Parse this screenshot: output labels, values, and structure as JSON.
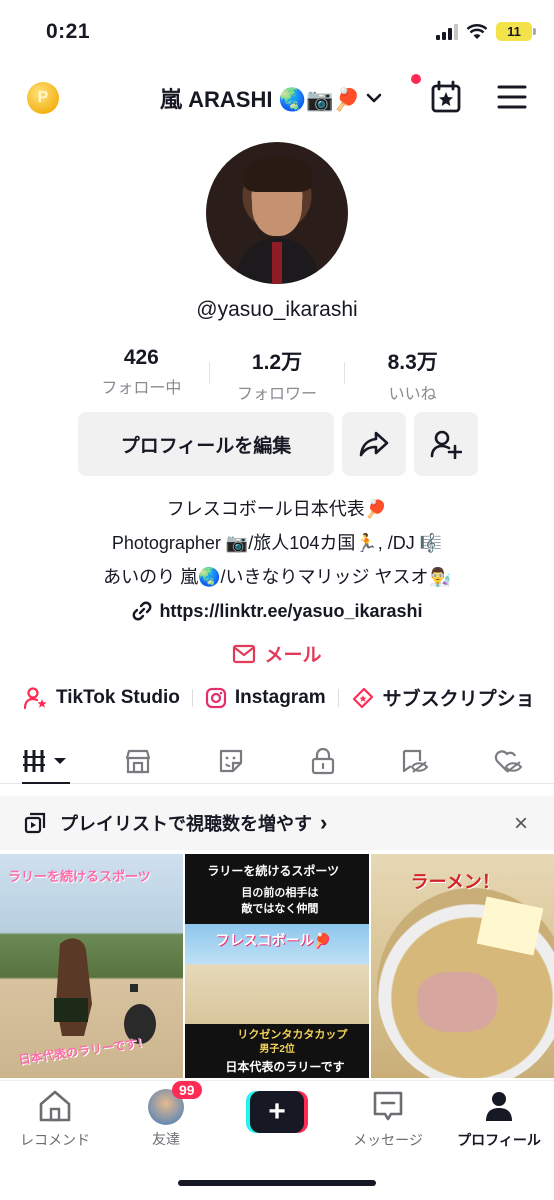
{
  "status_bar": {
    "time": "0:21",
    "battery": "11"
  },
  "header": {
    "username": "嵐 ARASHI 🌏📷🏓",
    "coin_label": "P"
  },
  "profile": {
    "handle": "@yasuo_ikarashi",
    "stats": [
      {
        "value": "426",
        "label": "フォロー中"
      },
      {
        "value": "1.2万",
        "label": "フォロワー"
      },
      {
        "value": "8.3万",
        "label": "いいね"
      }
    ],
    "edit_button": "プロフィールを編集",
    "bio": [
      "フレスコボール日本代表🏓",
      "Photographer 📷/旅人104カ国🏃, /DJ 🎼",
      "あいのり 嵐🌏/いきなりマリッジ ヤスオ👨‍🔬"
    ],
    "link": "https://linktr.ee/yasuo_ikarashi",
    "mail": "メール"
  },
  "quick_links": [
    {
      "label": "TikTok Studio"
    },
    {
      "label": "Instagram"
    },
    {
      "label": "サブスクリプショ"
    }
  ],
  "playlist_banner": {
    "text": "プレイリストで視聴数を増やす",
    "chevron": "›",
    "close": "×"
  },
  "videos": [
    {
      "caption_top": "ラリーを続けるスポーツ",
      "caption_bottom": "日本代表のラリーです！"
    },
    {
      "caption_top": "ラリーを続けるスポーツ",
      "caption_sub1": "目の前の相手は",
      "caption_sub2": "敵ではなく仲間",
      "caption_mid": "フレスコボール🏓",
      "caption_cup": "リクゼンタカタカップ",
      "caption_cup2": "男子2位",
      "caption_bottom": "日本代表のラリーです"
    },
    {
      "caption_top": "ラーメン！"
    }
  ],
  "bottom_nav": [
    {
      "label": "レコメンド"
    },
    {
      "label": "友達",
      "badge": "99"
    },
    {
      "label": "+"
    },
    {
      "label": "メッセージ"
    },
    {
      "label": "プロフィール"
    }
  ],
  "colors": {
    "accent": "#fe2c55",
    "mail": "#e23b5a",
    "cyan": "#25f4ee"
  }
}
